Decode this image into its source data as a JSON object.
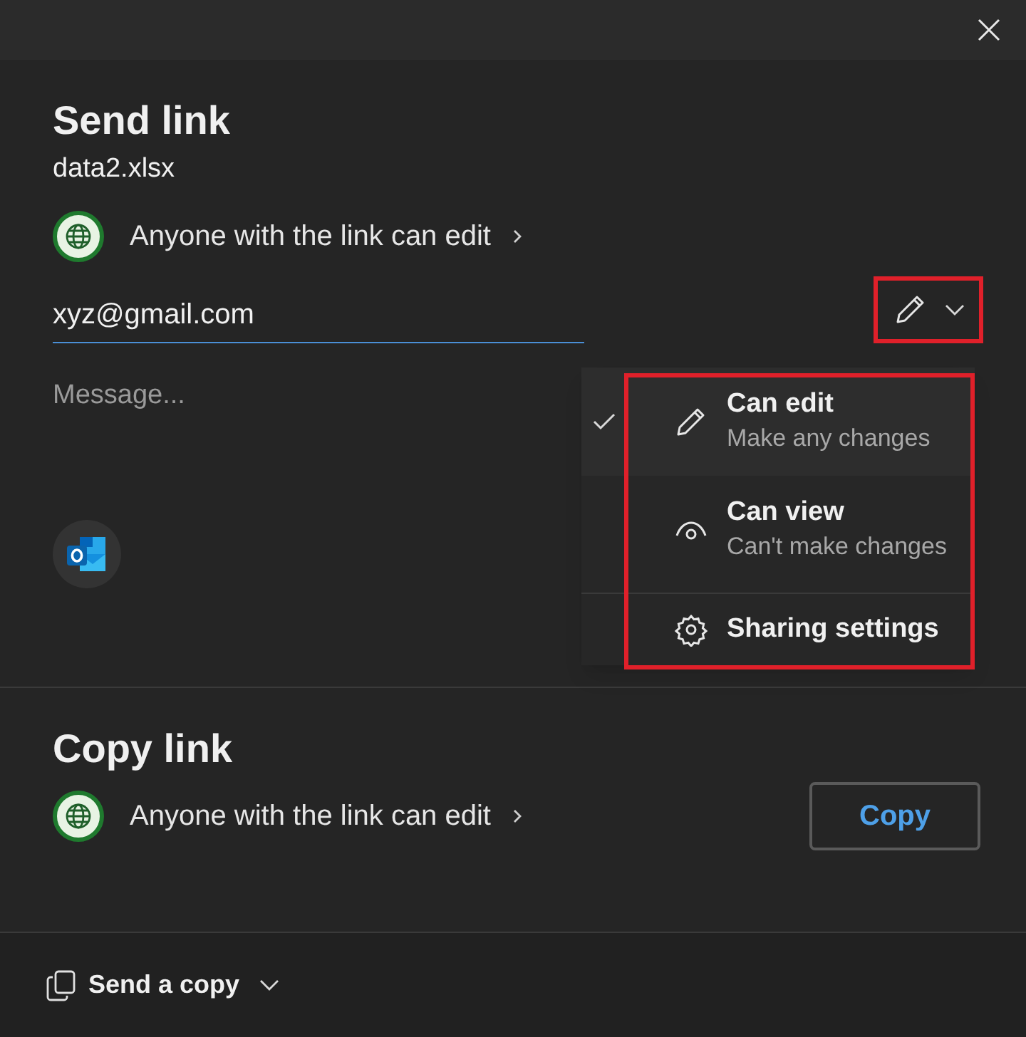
{
  "send_link": {
    "title": "Send link",
    "file_name": "data2.xlsx",
    "link_setting": "Anyone with the link can edit",
    "recipient": "xyz@gmail.com",
    "message_placeholder": "Message...",
    "permission_button": {
      "highlighted": true
    }
  },
  "permission_menu": {
    "highlighted": true,
    "items": [
      {
        "kind": "edit",
        "label": "Can edit",
        "description": "Make any changes",
        "selected": true
      },
      {
        "kind": "view",
        "label": "Can view",
        "description": "Can't make changes",
        "selected": false
      },
      {
        "kind": "settings",
        "label": "Sharing settings"
      }
    ]
  },
  "copy_link": {
    "title": "Copy link",
    "link_setting": "Anyone with the link can edit",
    "button": "Copy"
  },
  "footer": {
    "send_copy": "Send a copy"
  }
}
